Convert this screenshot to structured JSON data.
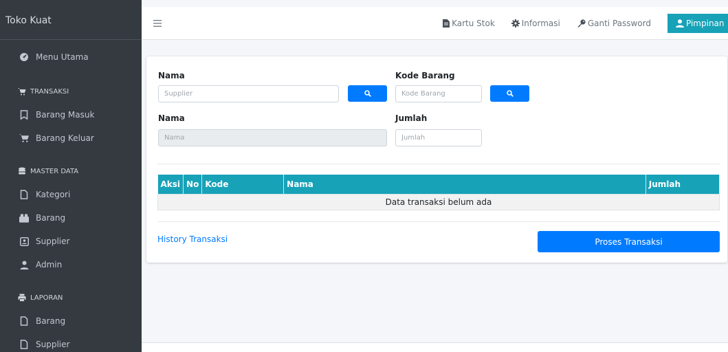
{
  "sidebar": {
    "brand": "Toko Kuat",
    "menu_utama": "Menu Utama",
    "sections": [
      {
        "header": "TRANSAKSI",
        "items": [
          "Barang Masuk",
          "Barang Keluar"
        ]
      },
      {
        "header": "MASTER DATA",
        "items": [
          "Kategori",
          "Barang",
          "Supplier",
          "Admin"
        ]
      },
      {
        "header": "LAPORAN",
        "items": [
          "Barang",
          "Supplier"
        ]
      }
    ]
  },
  "topbar": {
    "kartu_stok": "Kartu Stok",
    "informasi": "Informasi",
    "ganti_password": "Ganti Password",
    "user": "Pimpinan",
    "accent": "#17a2b8"
  },
  "form": {
    "supplier_label": "Nama",
    "supplier_placeholder": "Supplier",
    "kode_label": "Kode Barang",
    "kode_placeholder": "Kode Barang",
    "nama_label": "Nama",
    "nama_placeholder": "Nama",
    "jumlah_label": "Jumlah",
    "jumlah_placeholder": "Jumlah"
  },
  "table": {
    "headers": [
      "Aksi",
      "No",
      "Kode",
      "Nama",
      "Jumlah"
    ],
    "empty_message": "Data transaksi belum ada"
  },
  "actions": {
    "history": "History Transaksi",
    "proses": "Proses Transaksi",
    "primary_color": "#007bff"
  }
}
